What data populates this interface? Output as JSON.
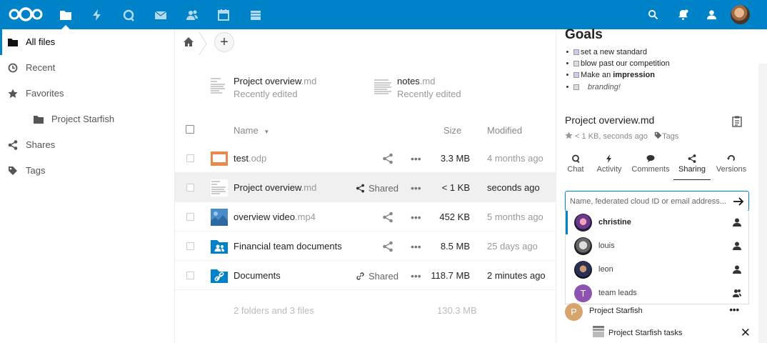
{
  "header": {
    "logo_icon": "nextcloud-logo-icon",
    "apps": [
      "files-icon",
      "activity-icon",
      "talk-icon",
      "mail-icon",
      "contacts-icon",
      "calendar-icon",
      "deck-icon"
    ],
    "right": [
      "search-icon",
      "notifications-icon",
      "contacts-menu-icon",
      "user-avatar"
    ],
    "accent": "#0082c9"
  },
  "nav": {
    "items": [
      {
        "label": "All files",
        "icon": "folder-icon"
      },
      {
        "label": "Recent",
        "icon": "clock-icon"
      },
      {
        "label": "Favorites",
        "icon": "star-icon"
      },
      {
        "label": "Project Starfish",
        "icon": "folder-icon"
      },
      {
        "label": "Shares",
        "icon": "share-icon"
      },
      {
        "label": "Tags",
        "icon": "tag-icon"
      }
    ]
  },
  "breadcrumb": {
    "add_label": "+"
  },
  "recent": [
    {
      "name": "Project overview",
      "ext": ".md",
      "sub": "Recently edited"
    },
    {
      "name": "notes",
      "ext": ".md",
      "sub": "Recently edited"
    }
  ],
  "table": {
    "headers": {
      "name": "Name",
      "size": "Size",
      "modified": "Modified"
    },
    "rows": [
      {
        "name": "test",
        "ext": ".odp",
        "share": "",
        "size": "3.3 MB",
        "modified": "4 months ago"
      },
      {
        "name": "Project overview",
        "ext": ".md",
        "share": "Shared",
        "size": "< 1 KB",
        "modified": "seconds ago"
      },
      {
        "name": "overview video",
        "ext": ".mp4",
        "share": "",
        "size": "452 KB",
        "modified": "5 months ago"
      },
      {
        "name": "Financial team documents",
        "ext": "",
        "share": "",
        "size": "8.5 MB",
        "modified": "25 days ago"
      },
      {
        "name": "Documents",
        "ext": "",
        "share": "Shared",
        "size": "118.7 MB",
        "modified": "2 minutes ago"
      }
    ],
    "more": "•••",
    "summary": {
      "label": "2 folders and 3 files",
      "size": "130.3 MB"
    }
  },
  "sidebar": {
    "preview_title": "Goals",
    "goals": [
      {
        "text": "set a new standard",
        "checked": true
      },
      {
        "text": "blow past our competition",
        "checked": false
      },
      {
        "text_prefix": "Make an ",
        "text_bold": "impression",
        "checked": true
      },
      {
        "text_italic": "branding!",
        "checked": false
      }
    ],
    "file_title": "Project overview.md",
    "meta": "< 1 KB, seconds ago",
    "tags": "Tags",
    "tabs": [
      "Chat",
      "Activity",
      "Comments",
      "Sharing",
      "Versions"
    ],
    "active_tab": "Sharing",
    "share_placeholder": "Name, federated cloud ID or email address...",
    "suggestions": [
      {
        "name": "christine",
        "type": "user"
      },
      {
        "name": "louis",
        "type": "user"
      },
      {
        "name": "leon",
        "type": "user"
      },
      {
        "name": "team leads",
        "type": "group",
        "initial": "T"
      }
    ],
    "share_entry": {
      "initial": "P",
      "name": "Project Starfish",
      "more": "•••"
    },
    "deck_entry": {
      "name": "Project Starfish tasks",
      "close": "✕"
    }
  }
}
